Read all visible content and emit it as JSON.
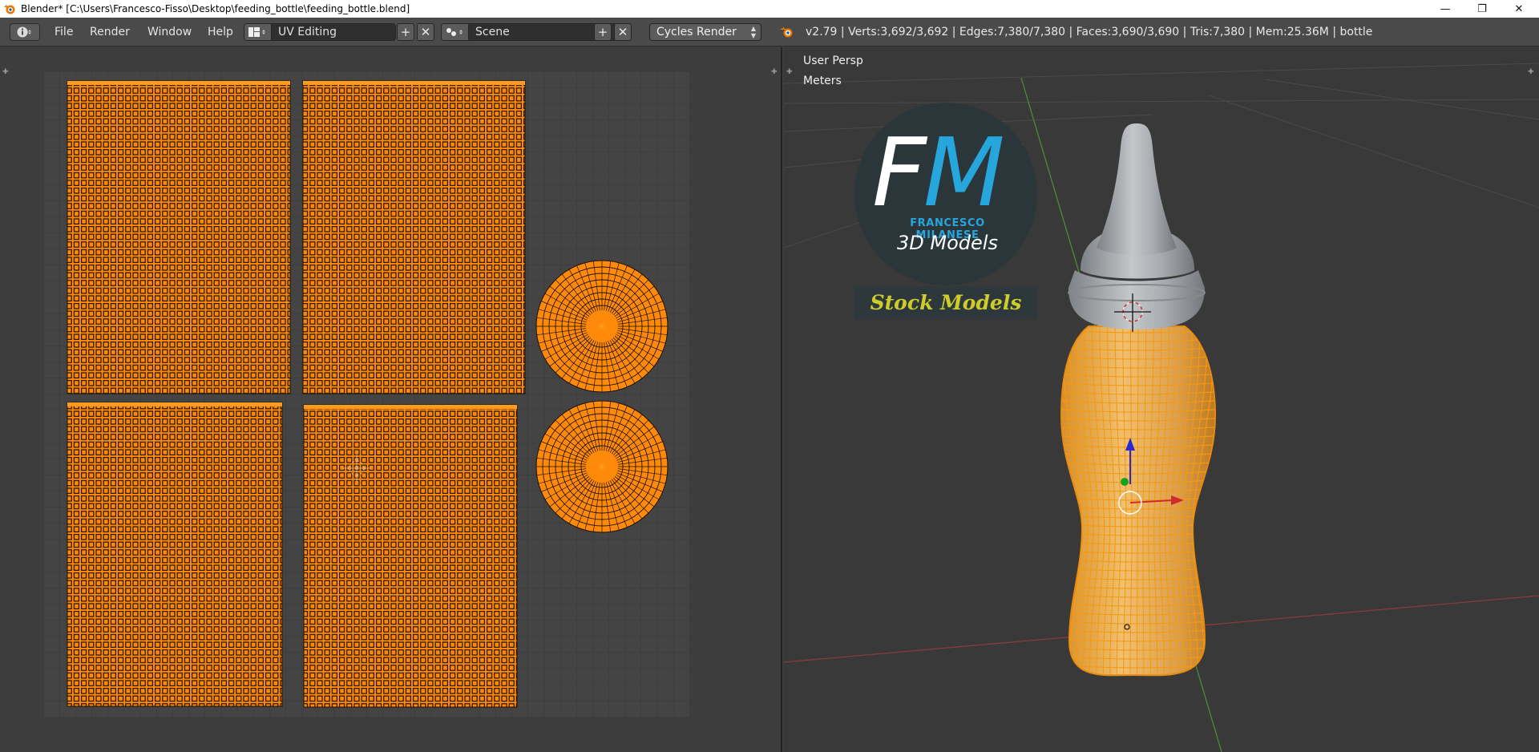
{
  "window": {
    "title": "Blender* [C:\\Users\\Francesco-Fisso\\Desktop\\feeding_bottle\\feeding_bottle.blend]",
    "minimize_glyph": "—",
    "restore_glyph": "❐",
    "close_glyph": "✕"
  },
  "header": {
    "editor_type_icon": "info-icon",
    "menus": [
      "File",
      "Render",
      "Window",
      "Help"
    ],
    "layout": {
      "name": "UV Editing",
      "add_glyph": "+",
      "close_glyph": "✕"
    },
    "scene": {
      "name": "Scene",
      "add_glyph": "+",
      "close_glyph": "✕"
    },
    "render_engine": "Cycles Render",
    "stats": "v2.79 | Verts:3,692/3,692 | Edges:7,380/7,380 | Faces:3,690/3,690 | Tris:7,380 | Mem:25.36M | bottle"
  },
  "viewport": {
    "view_label": "User Persp",
    "units_label": "Meters"
  },
  "watermark": {
    "letter_f": "F",
    "letter_m": "M",
    "name": "FRANCESCO MILANESE",
    "subtitle": "3D Models",
    "banner": "Stock Models"
  },
  "colors": {
    "uv_orange": "#ff8a0a",
    "mesh_orange": "#f5a623",
    "fm_blue": "#27a6dd",
    "stock_yellow": "#cfcc2a"
  }
}
